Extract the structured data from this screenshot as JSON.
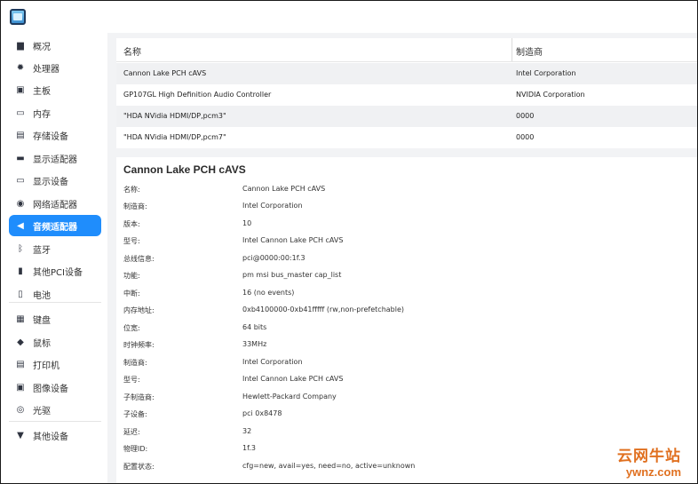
{
  "sidebar": {
    "items": [
      {
        "label": "概况",
        "icon": "monitor-icon"
      },
      {
        "label": "处理器",
        "icon": "cpu-icon"
      },
      {
        "label": "主板",
        "icon": "motherboard-icon"
      },
      {
        "label": "内存",
        "icon": "memory-icon"
      },
      {
        "label": "存储设备",
        "icon": "storage-icon"
      },
      {
        "label": "显示适配器",
        "icon": "display-adapter-icon"
      },
      {
        "label": "显示设备",
        "icon": "display-icon"
      },
      {
        "label": "网络适配器",
        "icon": "network-icon"
      },
      {
        "label": "音频适配器",
        "icon": "speaker-icon",
        "active": true
      },
      {
        "label": "蓝牙",
        "icon": "bluetooth-icon"
      },
      {
        "label": "其他PCI设备",
        "icon": "pci-icon"
      },
      {
        "label": "电池",
        "icon": "battery-icon"
      },
      {
        "label": "键盘",
        "icon": "keyboard-icon"
      },
      {
        "label": "鼠标",
        "icon": "mouse-icon"
      },
      {
        "label": "打印机",
        "icon": "printer-icon"
      },
      {
        "label": "图像设备",
        "icon": "camera-icon"
      },
      {
        "label": "光驱",
        "icon": "optical-drive-icon"
      },
      {
        "label": "其他设备",
        "icon": "other-device-icon"
      }
    ]
  },
  "list": {
    "headers": {
      "name": "名称",
      "vendor": "制造商"
    },
    "rows": [
      {
        "name": "Cannon Lake PCH cAVS",
        "vendor": "Intel Corporation"
      },
      {
        "name": "GP107GL High Definition Audio Controller",
        "vendor": "NVIDIA Corporation"
      },
      {
        "name": "\"HDA NVidia HDMI/DP,pcm3\"",
        "vendor": "0000"
      },
      {
        "name": "\"HDA NVidia HDMI/DP,pcm7\"",
        "vendor": "0000"
      }
    ]
  },
  "detail": {
    "title": "Cannon Lake PCH cAVS",
    "fields": [
      {
        "k": "名称:",
        "v": "Cannon Lake PCH cAVS"
      },
      {
        "k": "制造商:",
        "v": "Intel Corporation"
      },
      {
        "k": "版本:",
        "v": "10"
      },
      {
        "k": "型号:",
        "v": "Intel Cannon Lake PCH cAVS"
      },
      {
        "k": "总线信息:",
        "v": "pci@0000:00:1f.3"
      },
      {
        "k": "功能:",
        "v": "pm msi bus_master cap_list"
      },
      {
        "k": "中断:",
        "v": "16 (no events)"
      },
      {
        "k": "内存地址:",
        "v": "0xb4100000-0xb41fffff (rw,non-prefetchable)"
      },
      {
        "k": "位宽:",
        "v": "64 bits"
      },
      {
        "k": "时钟频率:",
        "v": "33MHz"
      },
      {
        "k": "制造商:",
        "v": "Intel Corporation"
      },
      {
        "k": "型号:",
        "v": "Intel Cannon Lake PCH cAVS"
      },
      {
        "k": "子制造商:",
        "v": "Hewlett-Packard Company"
      },
      {
        "k": "子设备:",
        "v": "pci 0x8478"
      },
      {
        "k": "延迟:",
        "v": "32"
      },
      {
        "k": "物理ID:",
        "v": "1f.3"
      },
      {
        "k": "配置状态:",
        "v": "cfg=new, avail=yes, need=no, active=unknown"
      }
    ]
  },
  "watermark": {
    "line1": "云网牛站",
    "line2": "ywnz.com"
  },
  "colors": {
    "accent": "#1f8dfc",
    "watermark": "#e07020"
  }
}
